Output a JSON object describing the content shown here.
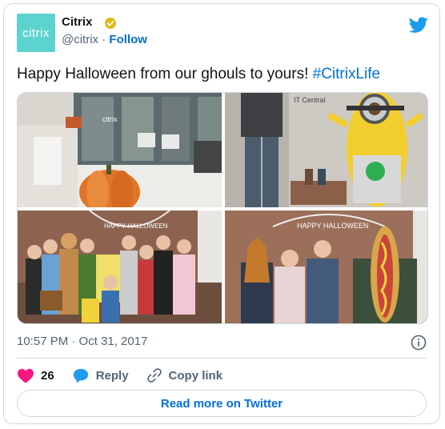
{
  "author": {
    "avatar_text": "citrix",
    "name": "Citrix",
    "handle": "@citrix",
    "separator": "·",
    "follow_label": "Follow"
  },
  "tweet": {
    "text": "Happy Halloween from our ghouls to yours! ",
    "hashtag": "#CitrixLife",
    "timestamp": "10:57 PM · Oct 31, 2017"
  },
  "photos": {
    "p1_sign": "citrix",
    "p2_sign": "IT Central",
    "p3_banner": "HAPPY HALLOWEEN",
    "p4_banner": "HAPPY HALLOWEEN"
  },
  "actions": {
    "like_count": "26",
    "reply_label": "Reply",
    "copy_label": "Copy link"
  },
  "read_more_label": "Read more on Twitter",
  "colors": {
    "accent": "#006fd6",
    "like": "#f91880",
    "avatar": "#5dd3cf",
    "verified": "#e2b719"
  }
}
